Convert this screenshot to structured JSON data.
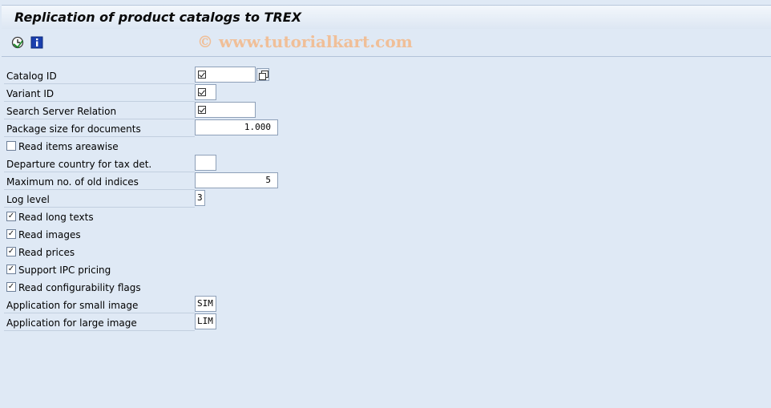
{
  "title": "Replication of product catalogs to TREX",
  "watermark": "© www.tutorialkart.com",
  "toolbar": {
    "execute_icon": "execute-clock-icon",
    "info_icon": "info-icon"
  },
  "fields": {
    "catalog_id": {
      "label": "Catalog ID",
      "value": ""
    },
    "variant_id": {
      "label": "Variant ID",
      "value": ""
    },
    "search_server_relation": {
      "label": "Search Server Relation",
      "value": ""
    },
    "package_size": {
      "label": "Package size for documents",
      "value": "1.000"
    },
    "read_items_areawise": {
      "label": "Read items areawise",
      "checked": false
    },
    "departure_country": {
      "label": "Departure country for tax det.",
      "value": ""
    },
    "max_old_indices": {
      "label": "Maximum no. of old indices",
      "value": "5"
    },
    "log_level": {
      "label": "Log level",
      "value": "3"
    },
    "read_long_texts": {
      "label": "Read long texts",
      "checked": true
    },
    "read_images": {
      "label": "Read images",
      "checked": true
    },
    "read_prices": {
      "label": "Read prices",
      "checked": true
    },
    "support_ipc_pricing": {
      "label": "Support IPC pricing",
      "checked": true
    },
    "read_configurability_flags": {
      "label": "Read configurability flags",
      "checked": true
    },
    "app_small_image": {
      "label": "Application for small image",
      "value": "SIM"
    },
    "app_large_image": {
      "label": "Application for large image",
      "value": "LIM"
    }
  },
  "colors": {
    "background": "#dfe9f5",
    "watermark": "#f0bf98"
  }
}
